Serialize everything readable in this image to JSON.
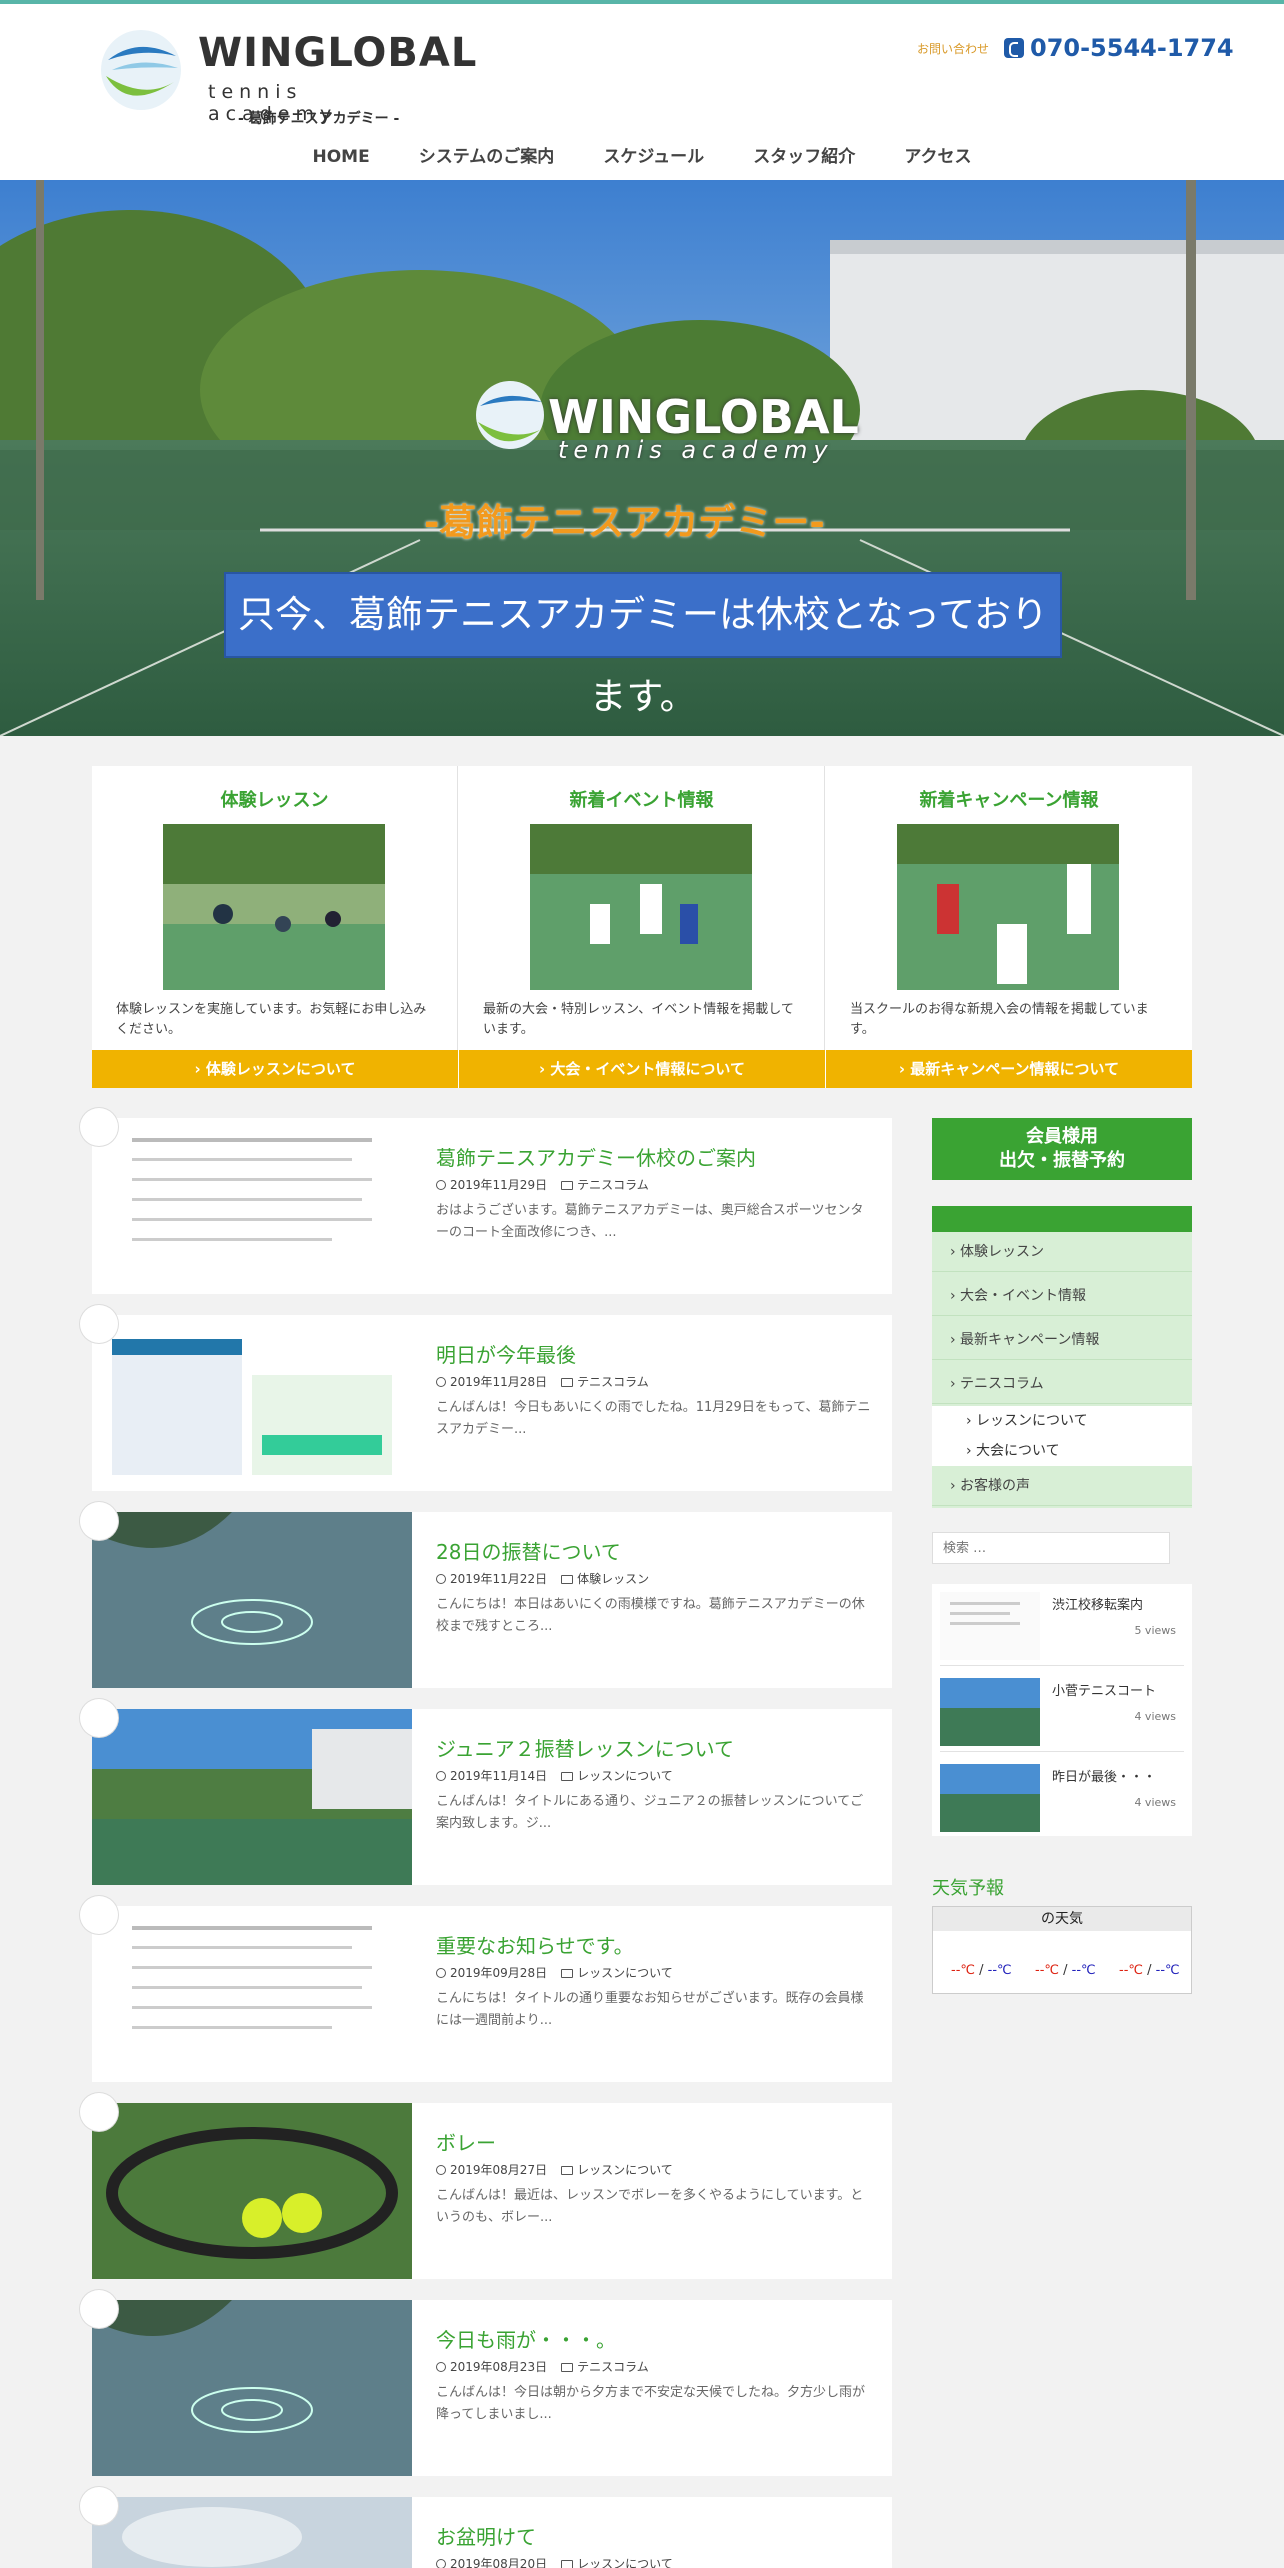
{
  "brand": {
    "logo_title": "WINGLOBAL",
    "logo_sub": "tennis academy",
    "logo_jp": "- 葛飾テニスアカデミー -",
    "contact_label": "お問い合わせ",
    "phone": "070-5544-1774"
  },
  "nav": [
    "HOME",
    "システムのご案内",
    "スケジュール",
    "スタッフ紹介",
    "アクセス"
  ],
  "hero": {
    "logo_title": "WINGLOBAL",
    "logo_sub": "tennis academy",
    "subtitle": "-葛飾テニスアカデミー-",
    "notice": "只今、葛飾テニスアカデミーは休校となっております。"
  },
  "features": [
    {
      "title": "体験レッスン",
      "text": "体験レッスンを実施しています。お気軽にお申し込みください。",
      "button": "› 体験レッスンについて"
    },
    {
      "title": "新着イベント情報",
      "text": "最新の大会・特別レッスン、イベント情報を掲載しています。",
      "button": "› 大会・イベント情報について"
    },
    {
      "title": "新着キャンペーン情報",
      "text": "当スクールのお得な新規入会の情報を掲載しています。",
      "button": "› 最新キャンペーン情報について"
    }
  ],
  "posts": [
    {
      "title": "葛飾テニスアカデミー休校のご案内",
      "date": "2019年11月29日",
      "category": "テニスコラム",
      "excerpt": "おはようございます。葛飾テニスアカデミーは、奥戸総合スポーツセンターのコート全面改修につき、..."
    },
    {
      "title": "明日が今年最後",
      "date": "2019年11月28日",
      "category": "テニスコラム",
      "excerpt": "こんばんは！今日もあいにくの雨でしたね。11月29日をもって、葛飾テニスアカデミー..."
    },
    {
      "title": "28日の振替について",
      "date": "2019年11月22日",
      "category": "体験レッスン",
      "excerpt": "こんにちは！本日はあいにくの雨模様ですね。葛飾テニスアカデミーの休校まで残すところ..."
    },
    {
      "title": "ジュニア２振替レッスンについて",
      "date": "2019年11月14日",
      "category": "レッスンについて",
      "excerpt": "こんばんは！タイトルにある通り、ジュニア２の振替レッスンについてご案内致します。ジ..."
    },
    {
      "title": "重要なお知らせです。",
      "date": "2019年09月28日",
      "category": "レッスンについて",
      "excerpt": "こんにちは！タイトルの通り重要なお知らせがございます。既存の会員様には一週間前より..."
    },
    {
      "title": "ボレー",
      "date": "2019年08月27日",
      "category": "レッスンについて",
      "excerpt": "こんばんは！最近は、レッスンでボレーを多くやるようにしています。というのも、ボレー..."
    },
    {
      "title": "今日も雨が・・・。",
      "date": "2019年08月23日",
      "category": "テニスコラム",
      "excerpt": "こんばんは！今日は朝から夕方まで不安定な天候でしたね。夕方少し雨が降ってしまいまし..."
    },
    {
      "title": "お盆明けて",
      "date": "2019年08月20日",
      "category": "レッスンについて",
      "excerpt": ""
    }
  ],
  "sidebar": {
    "member_button_line1": "会員様用",
    "member_button_line2": "出欠・振替予約",
    "categories": [
      "› 体験レッスン",
      "› 大会・イベント情報",
      "› 最新キャンペーン情報",
      "› テニスコラム"
    ],
    "subcategories": [
      "› レッスンについて",
      "› 大会について"
    ],
    "last_category": "› お客様の声",
    "search_placeholder": "検索 …",
    "popular": [
      {
        "title": "渋江校移転案内",
        "views": "5 views"
      },
      {
        "title": "小菅テニスコート",
        "views": "4 views"
      },
      {
        "title": "昨日が最後・・・",
        "views": "4 views"
      }
    ],
    "weather_title": "天気予報",
    "weather_head": "の天気",
    "temp_hi": "--℃",
    "temp_sep": " / ",
    "temp_lo": "--℃"
  },
  "colors": {
    "green": "#3aa333",
    "orange": "#f0b300",
    "blue": "#1f5aa8"
  }
}
